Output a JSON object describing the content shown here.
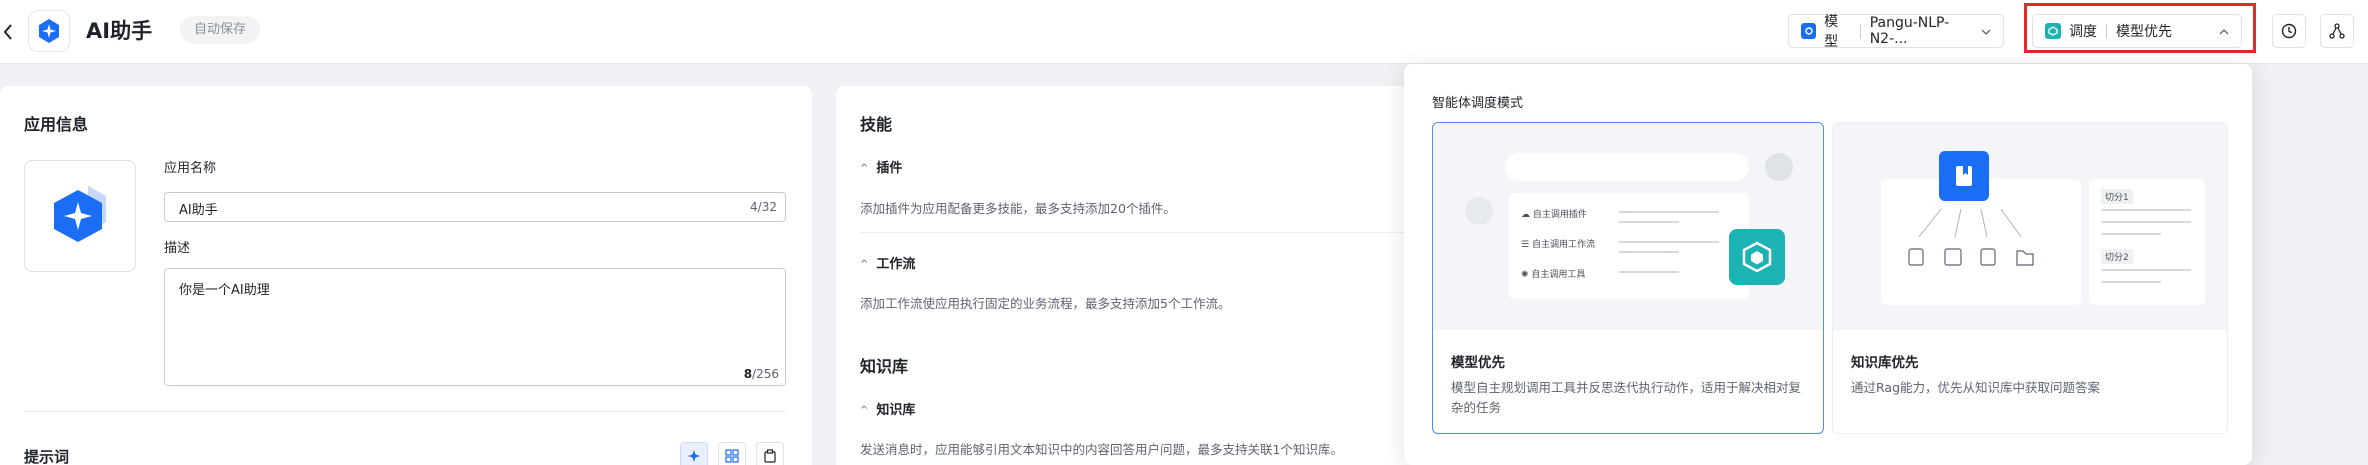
{
  "header": {
    "app_title": "AI助手",
    "autosave": "自动保存",
    "model_label": "模型",
    "model_value": "Pangu-NLP-N2-...",
    "schedule_label": "调度",
    "schedule_value": "模型优先"
  },
  "left": {
    "section_title": "应用信息",
    "name_label": "应用名称",
    "name_value": "AI助手",
    "name_counter": "4/32",
    "desc_label": "描述",
    "desc_value": "你是一个AI助理",
    "desc_counter_current": "8",
    "desc_counter_max": "/256",
    "prompt_title": "提示词"
  },
  "middle": {
    "skills_title": "技能",
    "plugin_label": "插件",
    "plugin_desc": "添加插件为应用配备更多技能，最多支持添加20个插件。",
    "workflow_label": "工作流",
    "workflow_desc": "添加工作流使应用执行固定的业务流程，最多支持添加5个工作流。",
    "kb_title": "知识库",
    "kb_label": "知识库",
    "kb_desc": "发送消息时，应用能够引用文本知识中的内容回答用户问题，最多支持关联1个知识库。"
  },
  "popover": {
    "title": "智能体调度模式",
    "cards": [
      {
        "title": "模型优先",
        "desc": "模型自主规划调用工具并反思迭代执行动作，适用于解决相对复杂的任务",
        "illu_items": [
          "自主调用插件",
          "自主调用工作流",
          "自主调用工具"
        ]
      },
      {
        "title": "知识库优先",
        "desc": "通过Rag能力，优先从知识库中获取问题答案",
        "illu_items": [
          "切分1",
          "切分2"
        ]
      }
    ]
  },
  "colors": {
    "accent": "#1a6ef5",
    "teal": "#1bb3b3",
    "highlight_border": "#e02b2b"
  }
}
